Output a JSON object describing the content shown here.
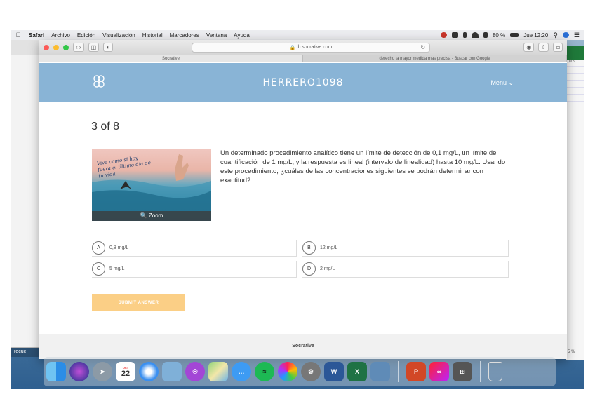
{
  "menubar": {
    "apple": "",
    "app": "Safari",
    "items": [
      "Archivo",
      "Edición",
      "Visualización",
      "Historial",
      "Marcadores",
      "Ventana",
      "Ayuda"
    ],
    "battery": "80 %",
    "clock": "Jue 12:20"
  },
  "browser": {
    "url": "b.socrative.com",
    "tabs": [
      "Socrative",
      "derecho la mayor medida mas precisa - Buscar con Google"
    ]
  },
  "app": {
    "room_name": "HERRERO1098",
    "menu_label": "Menu ⌄",
    "footer": "Socrative"
  },
  "question": {
    "progress": "3 of 8",
    "zoom_label": "🔍 Zoom",
    "text": "Un determinado procedimiento analítico tiene un límite de detección de 0,1 mg/L, un límite de cuantificación de 1 mg/L, y la respuesta es lineal (intervalo de linealidad) hasta 10 mg/L. Usando este procedimiento, ¿cuáles de las concentraciones siguientes se podrán determinar con exactitud?",
    "image_caption": "Vive como si hoy fuera el último día de tu vida",
    "options": [
      {
        "letter": "A",
        "text": "0,8 mg/L"
      },
      {
        "letter": "B",
        "text": "12 mg/L"
      },
      {
        "letter": "C",
        "text": "5 mg/L"
      },
      {
        "letter": "D",
        "text": "2 mg/L"
      }
    ],
    "submit_label": "SUBMIT ANSWER"
  },
  "desktop": {
    "left_window_label": "recuc",
    "right_window_label": "ulos",
    "right_window_pct": "5 %"
  },
  "dock": {
    "calendar_day": "22",
    "calendar_month": "OCT",
    "icons": [
      "finder-icon",
      "siri-icon",
      "launchpad-icon",
      "calendar-icon",
      "safari-icon",
      "preview-icon",
      "podcasts-icon",
      "maps-icon",
      "messages-icon",
      "spotify-icon",
      "photos-icon",
      "system-preferences-icon",
      "word-icon",
      "excel-icon",
      "image-capture-icon",
      "powerpoint-icon",
      "creative-cloud-icon",
      "calculator-icon",
      "trash-icon"
    ]
  }
}
